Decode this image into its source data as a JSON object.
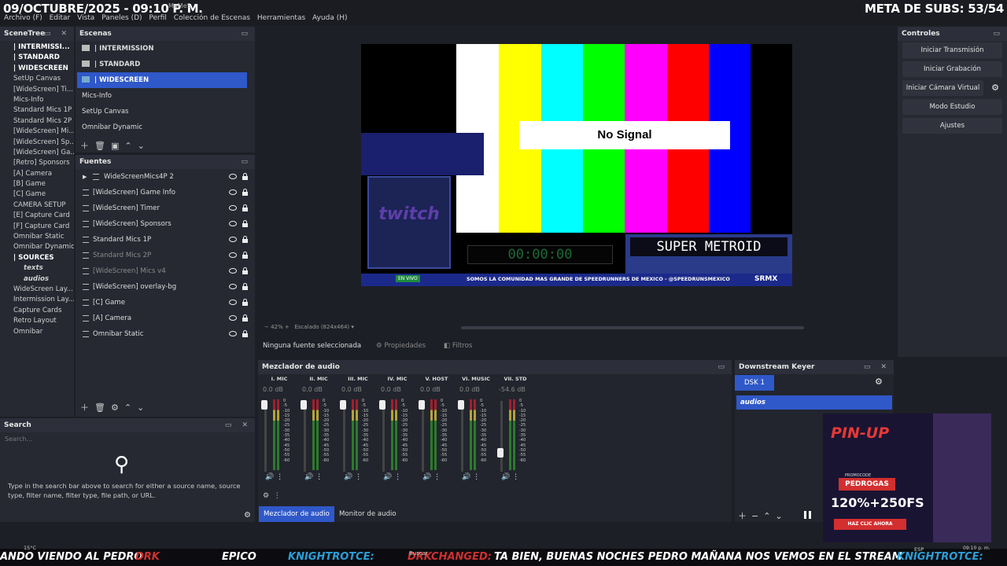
{
  "overlay": {
    "date_text": "09/OCTUBRE/2025 - 09:10 P. M.",
    "subs_goal": "META DE SUBS: 53/54",
    "window_title_fragment": "MaMeS"
  },
  "menu": [
    "Archivo (F)",
    "Editar",
    "Vista",
    "Paneles (D)",
    "Perfil",
    "Colección de Escenas",
    "Herramientas",
    "Ayuda (H)"
  ],
  "scenetree": {
    "title": "SceneTree",
    "items": [
      {
        "label": "| INTERMISSI...",
        "bold": true
      },
      {
        "label": "| STANDARD",
        "bold": true
      },
      {
        "label": "| WIDESCREEN",
        "bold": true
      },
      {
        "label": "SetUp Canvas"
      },
      {
        "label": "[WideScreen] Ti..."
      },
      {
        "label": "Mics-Info"
      },
      {
        "label": "Standard Mics 1P"
      },
      {
        "label": "Standard Mics 2P"
      },
      {
        "label": "[WideScreen] Mi..."
      },
      {
        "label": "[WideScreen] Sp..."
      },
      {
        "label": "[WideScreen] Ga..."
      },
      {
        "label": "[Retro] Sponsors"
      },
      {
        "label": "[A] Camera"
      },
      {
        "label": "[B] Game"
      },
      {
        "label": "[C] Game"
      },
      {
        "label": "CAMERA SETUP"
      },
      {
        "label": "[E] Capture Card"
      },
      {
        "label": "[F] Capture Card"
      },
      {
        "label": "Omnibar Static"
      },
      {
        "label": "Omnibar Dynamic"
      },
      {
        "label": "| SOURCES",
        "bold": true
      },
      {
        "label": "texts",
        "italic": true
      },
      {
        "label": "audios",
        "italic": true
      },
      {
        "label": "WideScreen Lay..."
      },
      {
        "label": "Intermission Lay..."
      },
      {
        "label": "Capture Cards"
      },
      {
        "label": "Retro Layout"
      },
      {
        "label": "Omnibar"
      }
    ]
  },
  "scenes": {
    "title": "Escenas",
    "items": [
      "| INTERMISSION",
      "| STANDARD",
      "| WIDESCREEN",
      "Mics-Info",
      "SetUp Canvas",
      "Omnibar Dynamic"
    ],
    "selected": 2
  },
  "sources": {
    "title": "Fuentes",
    "items": [
      {
        "label": "WideScreenMics4P 2",
        "dim": false
      },
      {
        "label": "[WideScreen] Game Info",
        "dim": false
      },
      {
        "label": "[WideScreen] Timer",
        "dim": false
      },
      {
        "label": "[WideScreen] Sponsors",
        "dim": false
      },
      {
        "label": "Standard Mics 1P",
        "dim": false
      },
      {
        "label": "Standard Mics 2P",
        "dim": true
      },
      {
        "label": "[WideScreen] Mics v4",
        "dim": true
      },
      {
        "label": "[WideScreen] overlay-bg",
        "dim": false
      },
      {
        "label": "[C] Game",
        "dim": false
      },
      {
        "label": "[A] Camera",
        "dim": false
      },
      {
        "label": "Omnibar Static",
        "dim": false
      }
    ]
  },
  "preview": {
    "no_signal": "No Signal",
    "timer": "00:00:00",
    "game": "SUPER METROID",
    "bottom_text": "SOMOS LA COMUNIDAD MAS GRANDE DE SPEEDRUNNERS DE MEXICO - @SPEEDRUNSMEXICO",
    "brand": "SRMX",
    "live_badge": "EN VIVO",
    "zoom": "42%",
    "scaling": "Escalado (824x464)"
  },
  "properties_bar": {
    "none_selected": "Ninguna fuente seleccionada",
    "properties": "Propiedades",
    "filters": "Filtros"
  },
  "search": {
    "title": "Search",
    "placeholder": "Search...",
    "hint": "Type in the search bar above to search for either a source name, source type, filter name, filter type, file path, or URL."
  },
  "controls": {
    "title": "Controles",
    "buttons": [
      "Iniciar Transmisión",
      "Iniciar Grabación",
      "Iniciar Cámara Virtual",
      "Modo Estudio",
      "Ajustes"
    ]
  },
  "mixer": {
    "title": "Mezclador de audio",
    "channels": [
      {
        "name": "I. MIC",
        "db": "0.0 dB"
      },
      {
        "name": "II. MIC",
        "db": "0.0 dB"
      },
      {
        "name": "III. MIC",
        "db": "0.0 dB"
      },
      {
        "name": "IV. MIC",
        "db": "0.0 dB"
      },
      {
        "name": "V. HOST",
        "db": "0.0 dB"
      },
      {
        "name": "VI. MUSIC",
        "db": "0.0 dB"
      },
      {
        "name": "VII. STD",
        "db": "-54.6 dB"
      }
    ],
    "scale": [
      "0",
      "-5",
      "-10",
      "-15",
      "-20",
      "-25",
      "-30",
      "-35",
      "-40",
      "-45",
      "-50",
      "-55",
      "-60"
    ],
    "tabs": [
      "Mezclador de audio",
      "Monitor de audio"
    ]
  },
  "dsk": {
    "title": "Downstream Keyer",
    "tab": "DSK 1",
    "item": "audios"
  },
  "ad": {
    "brand": "PIN-UP",
    "promo": "PROMOCODE",
    "code": "PEDROGAS",
    "offer": "120%+250FS",
    "cta": "HAZ CLIC AHORA"
  },
  "ticker": {
    "items": [
      "ANDO VIENDO AL PEDRO",
      "DRK",
      "EPICO",
      "KNIGHTROTCE:",
      "DRKCHANGED:",
      "TA BIEN, BUENAS NOCHES PEDRO MAÑANA NOS VEMOS EN EL STREAM",
      "KNIGHTROTCE:"
    ],
    "weather": "15°C",
    "search": "Buscar",
    "lang": "ESP",
    "clock": "09:10 p. m."
  }
}
